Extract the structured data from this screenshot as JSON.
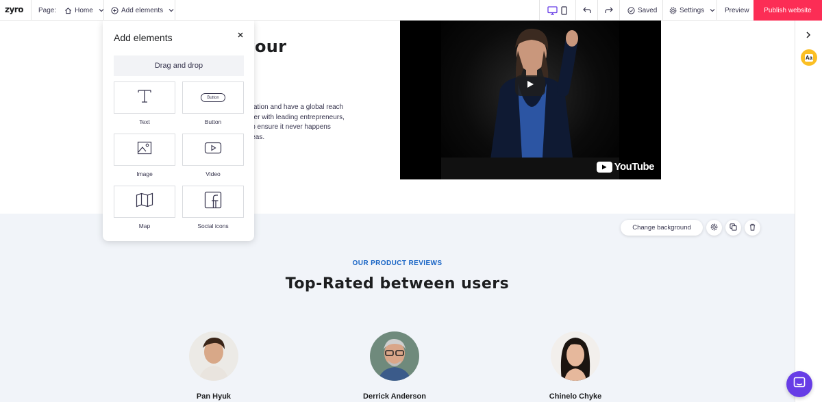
{
  "topbar": {
    "logo": "zyro",
    "page_label": "Page:",
    "page_value": "Home",
    "add_elements": "Add elements",
    "saved": "Saved",
    "settings": "Settings",
    "preview": "Preview",
    "publish": "Publish website"
  },
  "panel": {
    "title": "Add elements",
    "drag_and_drop": "Drag and drop",
    "tiles": [
      {
        "label": "Text",
        "icon": "text-icon"
      },
      {
        "label": "Button",
        "icon": "button-icon",
        "icon_text": "Button"
      },
      {
        "label": "Image",
        "icon": "image-icon"
      },
      {
        "label": "Video",
        "icon": "video-icon"
      },
      {
        "label": "Map",
        "icon": "map-icon"
      },
      {
        "label": "Social icons",
        "icon": "facebook-icon"
      }
    ]
  },
  "hero": {
    "title_fragment": "n your",
    "text_lines": [
      "vation and have a global reach",
      "her with leading entrepreneurs,",
      "lp ensure it never happens",
      "leas."
    ]
  },
  "video": {
    "brand": "YouTube"
  },
  "reviews": {
    "subtitle": "OUR PRODUCT REVIEWS",
    "title": "Top-Rated between users",
    "people": [
      {
        "name": "Pan Hyuk"
      },
      {
        "name": "Derrick Anderson"
      },
      {
        "name": "Chinelo Chyke"
      }
    ],
    "change_background": "Change background"
  },
  "colors": {
    "accent": "#fc2d55",
    "brand_blue": "#1864c5",
    "chat": "#673de6",
    "section_bg": "#f1f4f9"
  }
}
